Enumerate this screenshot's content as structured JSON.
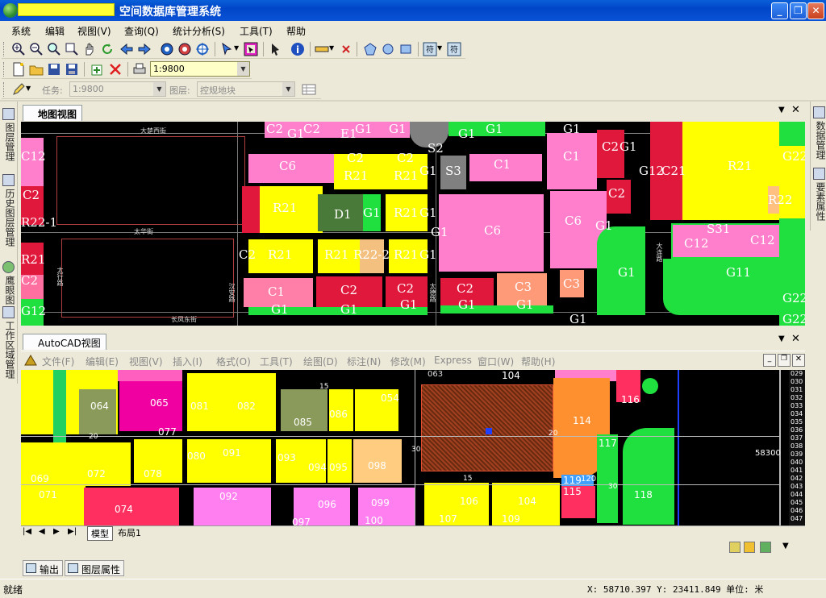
{
  "window": {
    "title": "空间数据库管理系统",
    "min": "_",
    "max": "❐",
    "close": "✕"
  },
  "menu": [
    "系统",
    "编辑",
    "视图(V)",
    "查询(Q)",
    "统计分析(S)",
    "工具(T)",
    "帮助"
  ],
  "toolbar2": {
    "scale": "1:9800"
  },
  "toolbar3": {
    "task_label": "任务:",
    "task_value": "1:9800",
    "layer_label": "图层:",
    "layer_value": "控规地块"
  },
  "left_dock": [
    "图层管理",
    "历史图层管理",
    "鹰眼图",
    "工作区域管理"
  ],
  "right_dock": [
    "数据管理",
    "要素属性"
  ],
  "map_view": {
    "tab": "地图视图",
    "roads": [
      "大楚西街",
      "太华街",
      "长凤东街",
      "汉安路",
      "太行路",
      "太德路",
      "大连路"
    ],
    "labels": [
      "C2",
      "G1",
      "C2",
      "E1",
      "G1",
      "G1",
      "S2",
      "G1",
      "G1",
      "G1",
      "C12",
      "C6",
      "C2",
      "C2",
      "R21",
      "R21",
      "G1",
      "S3",
      "C1",
      "C1",
      "C2",
      "G1",
      "G12",
      "C21",
      "R21",
      "G22",
      "C2",
      "R21",
      "D1",
      "G1",
      "R21",
      "G1",
      "R22",
      "C2",
      "C6",
      "C6",
      "G1",
      "R22-1",
      "G1",
      "S31",
      "C12",
      "C12",
      "R21",
      "C2",
      "R21",
      "R21",
      "R22-2",
      "R21",
      "G1",
      "G1",
      "G11",
      "C2",
      "C1",
      "C2",
      "C2",
      "C2",
      "C3",
      "C3",
      "G12",
      "G1",
      "G1",
      "G1",
      "G1",
      "G1",
      "G22",
      "G1",
      "G22"
    ]
  },
  "cad_view": {
    "tab": "AutoCAD视图",
    "menu": [
      "文件(F)",
      "编辑(E)",
      "视图(V)",
      "插入(I)",
      "格式(O)",
      "工具(T)",
      "绘图(D)",
      "标注(N)",
      "修改(M)",
      "Express",
      "窗口(W)",
      "帮助(H)"
    ],
    "tabs": [
      "模型",
      "布局1"
    ],
    "parcels": [
      "064",
      "065",
      "081",
      "082",
      "085",
      "086",
      "054",
      "114",
      "116",
      "077",
      "069",
      "071",
      "072",
      "074",
      "078",
      "080",
      "091",
      "093",
      "094",
      "095",
      "098",
      "117",
      "118",
      "119",
      "120",
      "115",
      "092",
      "096",
      "099",
      "106",
      "104",
      "107",
      "109",
      "100",
      "097",
      "098",
      "104",
      "063"
    ],
    "misc_numbers": [
      "58300",
      "15",
      "20",
      "30",
      "15",
      "30",
      "20"
    ],
    "right_col": [
      "029",
      "030",
      "031",
      "032",
      "033",
      "034",
      "035",
      "036",
      "037",
      "038",
      "039",
      "040",
      "041",
      "042",
      "043",
      "044",
      "045",
      "046",
      "047"
    ]
  },
  "bottom_tabs": [
    "输出",
    "图层属性"
  ],
  "status": {
    "left": "就绪",
    "coords": "X: 58710.397 Y: 23411.849 单位: 米"
  }
}
